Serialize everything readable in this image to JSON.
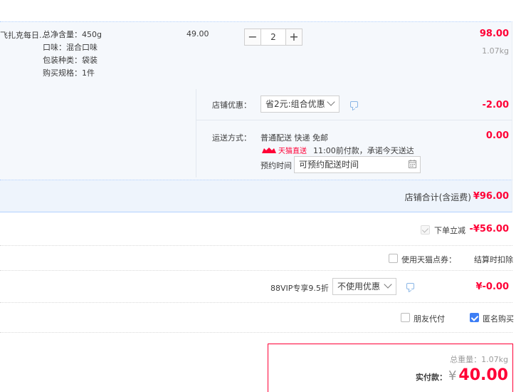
{
  "product": {
    "title": "飞扎克每日...",
    "attrs": [
      "总净含量：450g",
      "口味：混合口味",
      "包装种类：袋装",
      "购买规格：1件"
    ],
    "unit_price": "49.00",
    "quantity": "2",
    "minus": "−",
    "plus": "+",
    "subtotal": "98.00",
    "weight": "1.07kg"
  },
  "shop": {
    "discount_label": "店铺优惠：",
    "discount_option": "省2元:组合优惠",
    "discount_amount": "-2.00",
    "shipping_label": "运送方式：",
    "shipping_desc": "普通配送 快递 免邮",
    "tmall_badge": "天猫直送",
    "delivery_promise": "11:00前付款，承诺今天送达",
    "appointment_label": "预约时间",
    "appointment_placeholder": "可预约配送时间",
    "shipping_amount": "0.00",
    "total_label": "店铺合计(含运费)",
    "total_amount": "¥96.00"
  },
  "order_options": {
    "instant_discount_label": "下单立减",
    "instant_discount_amount": "-¥56.00",
    "tmall_points_label": "使用天猫点券：",
    "tmall_points_note": "结算时扣除",
    "vip_label": "88VIP专享9.5折",
    "vip_option": "不使用优惠",
    "vip_amount": "¥-0.00",
    "friend_pay_label": "朋友代付",
    "anonymous_label": "匿名购买"
  },
  "summary": {
    "weight_label": "总重量：",
    "weight_value": "1.07kg",
    "pay_label": "实付款：",
    "currency": "¥",
    "pay_amount": "40.00"
  },
  "colors": {
    "accent": "#ff0036",
    "link_blue": "#3d7ef5",
    "panel_bg": "#f5f8fc"
  },
  "icons": [
    "calendar-icon",
    "message-icon",
    "chevron-down-icon",
    "checkbox-checked-icon"
  ]
}
